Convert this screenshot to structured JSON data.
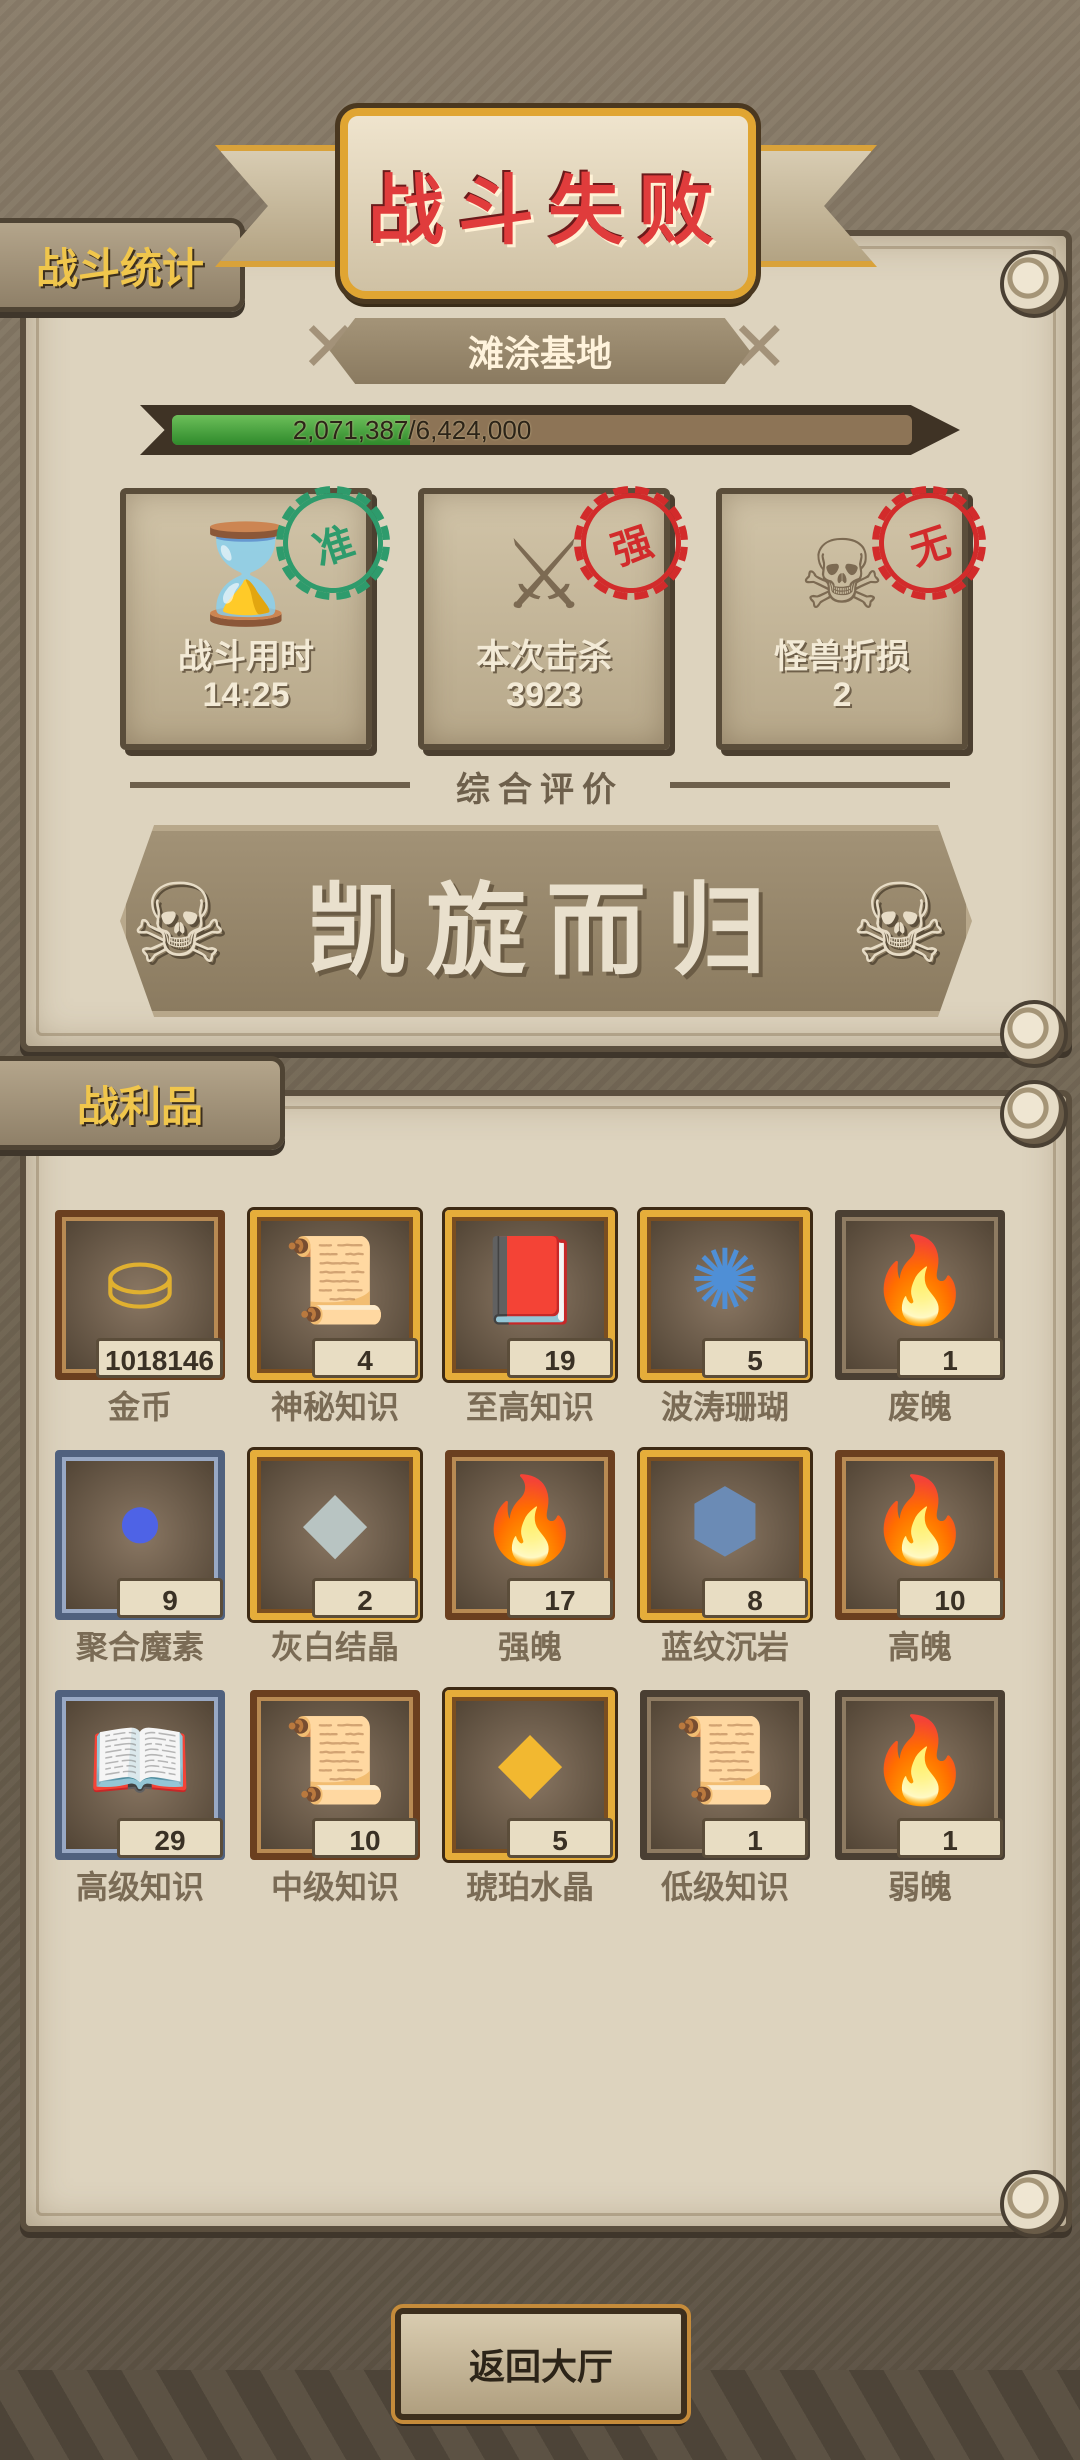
{
  "title": "战斗失败",
  "sections": {
    "stats": "战斗统计",
    "loot": "战利品"
  },
  "location": "滩涂基地",
  "progress": {
    "text": "2,071,387/6,424,000",
    "current": 2071387,
    "total": 6424000,
    "percent": 32.2
  },
  "stats": [
    {
      "label": "战斗用时",
      "value": "14:25",
      "icon": "hourglass-icon",
      "stamp": "准",
      "stamp_color": "green"
    },
    {
      "label": "本次击杀",
      "value": "3923",
      "icon": "crossed-swords-icon",
      "stamp": "强",
      "stamp_color": "red"
    },
    {
      "label": "怪兽折损",
      "value": "2",
      "icon": "skull-icon",
      "stamp": "无",
      "stamp_color": "red"
    }
  ],
  "rating": {
    "label": "综合评价",
    "grade": "凯旋而归"
  },
  "loot": [
    {
      "name": "金币",
      "count": "1018146",
      "icon": "gold-coin-icon",
      "frame": "brown",
      "glyph": "⛀",
      "color": "#e0b030"
    },
    {
      "name": "神秘知识",
      "count": "4",
      "icon": "tablet-icon",
      "frame": "gold",
      "glyph": "📜",
      "color": "#d6c7a5"
    },
    {
      "name": "至高知识",
      "count": "19",
      "icon": "purple-book-icon",
      "frame": "gold",
      "glyph": "📕",
      "color": "#7a4fa8"
    },
    {
      "name": "波涛珊瑚",
      "count": "5",
      "icon": "coral-icon",
      "frame": "gold",
      "glyph": "✺",
      "color": "#4f8fd6"
    },
    {
      "name": "废魄",
      "count": "1",
      "icon": "pale-flame-icon",
      "frame": "plain",
      "glyph": "🔥",
      "color": "#f2c08a"
    },
    {
      "name": "聚合魔素",
      "count": "9",
      "icon": "blue-orb-icon",
      "frame": "blue",
      "glyph": "●",
      "color": "#4e63e6"
    },
    {
      "name": "灰白结晶",
      "count": "2",
      "icon": "gray-crystal-icon",
      "frame": "gold",
      "glyph": "◆",
      "color": "#b8c4c2"
    },
    {
      "name": "强魄",
      "count": "17",
      "icon": "orange-flame-icon",
      "frame": "brown",
      "glyph": "🔥",
      "color": "#f0a050"
    },
    {
      "name": "蓝纹沉岩",
      "count": "8",
      "icon": "blue-rock-icon",
      "frame": "gold",
      "glyph": "⬢",
      "color": "#6b8bb5"
    },
    {
      "name": "高魄",
      "count": "10",
      "icon": "red-flame-icon",
      "frame": "brown",
      "glyph": "🔥",
      "color": "#e0502a"
    },
    {
      "name": "高级知识",
      "count": "29",
      "icon": "brown-book-icon",
      "frame": "blue",
      "glyph": "📖",
      "color": "#8a5a3a"
    },
    {
      "name": "中级知识",
      "count": "10",
      "icon": "scroll-icon",
      "frame": "brown",
      "glyph": "📜",
      "color": "#c7c3b0"
    },
    {
      "name": "琥珀水晶",
      "count": "5",
      "icon": "amber-crystal-icon",
      "frame": "gold",
      "glyph": "◆",
      "color": "#f2b830"
    },
    {
      "name": "低级知识",
      "count": "1",
      "icon": "small-scroll-icon",
      "frame": "plain",
      "glyph": "📜",
      "color": "#a09480"
    },
    {
      "name": "弱魄",
      "count": "1",
      "icon": "small-flame-icon",
      "frame": "plain",
      "glyph": "🔥",
      "color": "#f3b98a"
    }
  ],
  "return_button": "返回大厅"
}
